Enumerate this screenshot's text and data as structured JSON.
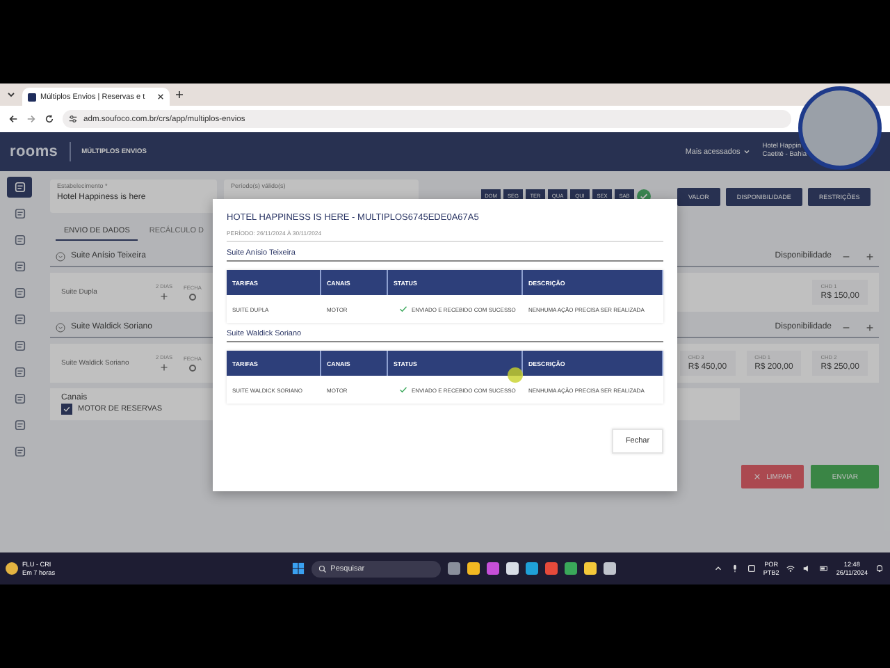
{
  "browser": {
    "tab_title": "Múltiplos Envios | Reservas e t",
    "url": "adm.soufoco.com.br/crs/app/multiplos-envios"
  },
  "app_header": {
    "logo": "rooms",
    "page_title": "MÚLTIPLOS ENVIOS",
    "menu": "Mais acessados",
    "hotel_name": "Hotel Happin",
    "hotel_city": "Caetité - Bahia"
  },
  "sidebar": {
    "items": [
      {
        "selected": true
      },
      {
        "selected": false
      },
      {
        "selected": false
      },
      {
        "selected": false
      },
      {
        "selected": false
      },
      {
        "selected": false
      },
      {
        "selected": false
      },
      {
        "selected": false
      },
      {
        "selected": false
      },
      {
        "selected": false
      },
      {
        "selected": false
      }
    ]
  },
  "filters": {
    "establishment_label": "Estabelecimento *",
    "establishment_value": "Hotel Happiness is here",
    "period_label": "Período(s) válido(s)",
    "weekdays": [
      {
        "label": "DOM",
        "selected": true
      },
      {
        "label": "SEG",
        "selected": true
      },
      {
        "label": "TER",
        "selected": true
      },
      {
        "label": "QUA",
        "selected": true
      },
      {
        "label": "QUI",
        "selected": true
      },
      {
        "label": "SEX",
        "selected": true
      },
      {
        "label": "SAB",
        "selected": true
      }
    ],
    "buttons": [
      "VALOR",
      "DISPONIBILIDADE",
      "RESTRIÇÕES"
    ]
  },
  "tabs": [
    {
      "label": "ENVIO DE DADOS",
      "selected": true
    },
    {
      "label": "RECÁLCULO D",
      "selected": false
    }
  ],
  "sections": [
    {
      "title": "Suite Anísio Teixeira",
      "availability_label": "Disponibilidade",
      "rows": [
        {
          "name": "Suite Dupla",
          "days_label": "2 DIAS",
          "closed_label": "FECHA",
          "closed_selected": false,
          "prices": [
            {
              "label": "CHD 1",
              "value": "R$ 150,00"
            }
          ]
        }
      ]
    },
    {
      "title": "Suite Waldick Soriano",
      "availability_label": "Disponibilidade",
      "rows": [
        {
          "name": "Suite Waldick Soriano",
          "days_label": "2 DIAS",
          "closed_label": "FECHA",
          "closed_selected": false,
          "prices": [
            {
              "label": "CHD 3",
              "value": "R$ 450,00"
            },
            {
              "label": "CHD 1",
              "value": "R$ 200,00"
            },
            {
              "label": "CHD 2",
              "value": "R$ 250,00"
            }
          ]
        }
      ]
    }
  ],
  "channels": {
    "label": "Canais",
    "items": [
      {
        "label": "MOTOR DE RESERVAS",
        "checked": true
      }
    ]
  },
  "actions": [
    {
      "kind": "clear",
      "label": "LIMPAR"
    },
    {
      "kind": "send",
      "label": "ENVIAR"
    }
  ],
  "modal": {
    "title": "HOTEL HAPPINESS IS HERE - MULTIPLOS6745EDE0A67A5",
    "period": "PERÍODO: 26/11/2024 À 30/11/2024",
    "sections": [
      {
        "title": "Suite Anísio Teixeira",
        "columns": [
          "TARIFAS",
          "CANAIS",
          "STATUS",
          "DESCRIÇÃO"
        ],
        "rows": [
          {
            "rate": "SUITE DUPLA",
            "channel": "MOTOR",
            "success": true,
            "status": "ENVIADO E RECEBIDO COM SUCESSO",
            "description": "NENHUMA AÇÃO PRECISA SER REALIZADA"
          }
        ]
      },
      {
        "title": "Suite Waldick Soriano",
        "columns": [
          "TARIFAS",
          "CANAIS",
          "STATUS",
          "DESCRIÇÃO"
        ],
        "rows": [
          {
            "rate": "SUITE WALDICK SORIANO",
            "channel": "MOTOR",
            "success": true,
            "status": "ENVIADO E RECEBIDO COM SUCESSO",
            "description": "NENHUMA AÇÃO PRECISA SER REALIZADA"
          }
        ]
      }
    ],
    "close_button": "Fechar"
  },
  "taskbar": {
    "weather_title": "FLU - CRI",
    "weather_subtitle": "Em 7 horas",
    "search_placeholder": "Pesquisar",
    "language": "POR",
    "layout": "PTB2",
    "time": "12:48",
    "date": "26/11/2024"
  }
}
